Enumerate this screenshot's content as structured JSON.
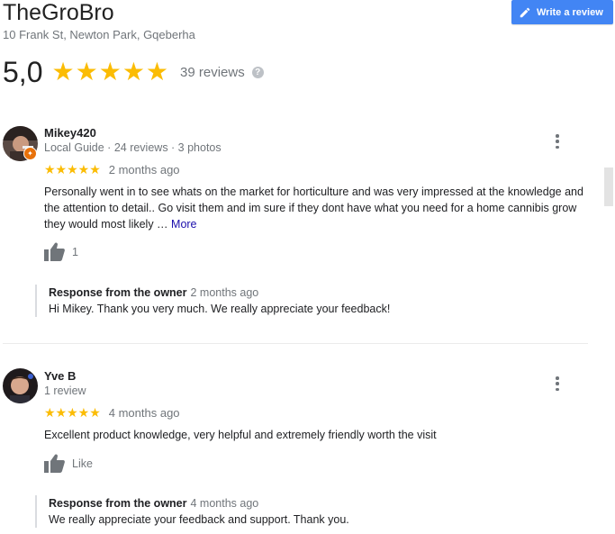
{
  "business": {
    "name": "TheGroBro",
    "address": "10 Frank St, Newton Park, Gqeberha"
  },
  "write_review_button": {
    "label": "Write a review",
    "icon": "pencil-icon"
  },
  "summary": {
    "rating": "5,0",
    "stars": 5,
    "review_count": "39 reviews",
    "help_icon": "?"
  },
  "colors": {
    "star": "#fbbc04",
    "button": "#4285f4",
    "link": "#1a0dab",
    "local_guide_badge": "#e8710a"
  },
  "reviews": [
    {
      "author": "Mikey420",
      "meta": "Local Guide · 24 reviews · 3 photos",
      "stars": 5,
      "date": "2 months ago",
      "text": "Personally went in to see whats on the market for horticulture and was very impressed at the knowledge and the attention to detail.. Go visit them and im sure if they dont have what you need for a home cannibis grow they would most likely … ",
      "more_label": "More",
      "likes": "1",
      "owner_response": {
        "title": "Response from the owner",
        "date": "2 months ago",
        "text": "Hi Mikey. Thank you very much. We really appreciate your feedback!"
      }
    },
    {
      "author": "Yve B",
      "meta": "1 review",
      "stars": 5,
      "date": "4 months ago",
      "text": "Excellent product knowledge, very helpful and extremely friendly worth the visit",
      "likes": "Like",
      "owner_response": {
        "title": "Response from the owner",
        "date": "4 months ago",
        "text": "We really appreciate your feedback and support. Thank you."
      }
    }
  ]
}
